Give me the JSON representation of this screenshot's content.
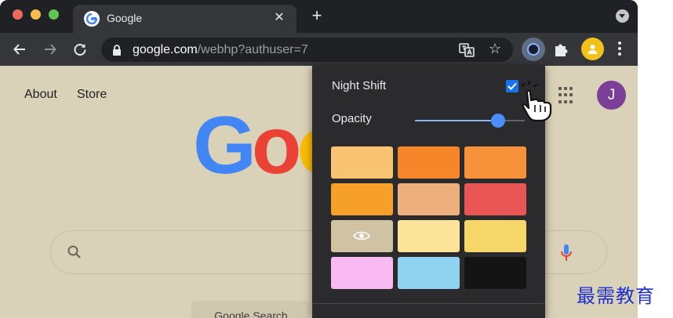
{
  "tab": {
    "title": "Google",
    "close": "✕"
  },
  "new_tab_label": "+",
  "toolbar": {
    "url_domain": "google.com",
    "url_path": "/webhp?authuser=7",
    "star": "☆"
  },
  "page": {
    "about_link": "About",
    "store_link": "Store",
    "avatar_letter": "J",
    "logo_letters": [
      "G",
      "o",
      "o"
    ],
    "logo_colors": [
      "#4285f4",
      "#ea4335",
      "#fbbc05"
    ],
    "search_button": "Google Search"
  },
  "popup": {
    "night_shift_label": "Night Shift",
    "night_shift_checked": true,
    "opacity_label": "Opacity",
    "opacity_level": 0.76,
    "swatches": [
      {
        "color": "#f8c471",
        "icon": ""
      },
      {
        "color": "#f5862a",
        "icon": ""
      },
      {
        "color": "#f7913a",
        "icon": ""
      },
      {
        "color": "#f7a029",
        "icon": ""
      },
      {
        "color": "#edb07c",
        "icon": ""
      },
      {
        "color": "#ea5655",
        "icon": ""
      },
      {
        "color": "#cfc3a4",
        "icon": "eye-icon"
      },
      {
        "color": "#fbe39a",
        "icon": ""
      },
      {
        "color": "#f6d86a",
        "icon": ""
      },
      {
        "color": "#f9b9f2",
        "icon": ""
      },
      {
        "color": "#90d3f0",
        "icon": ""
      },
      {
        "color": "#141414",
        "icon": ""
      }
    ]
  },
  "watermark": "最需教育",
  "colors": {
    "tab_strip": "#202124",
    "toolbar": "#35363a",
    "page_bg": "#dad2b8",
    "popup_bg": "#2b2b2d",
    "accent_blue": "#1a73e8",
    "avatar": "#7b3f98",
    "profile": "#f2c21b"
  }
}
